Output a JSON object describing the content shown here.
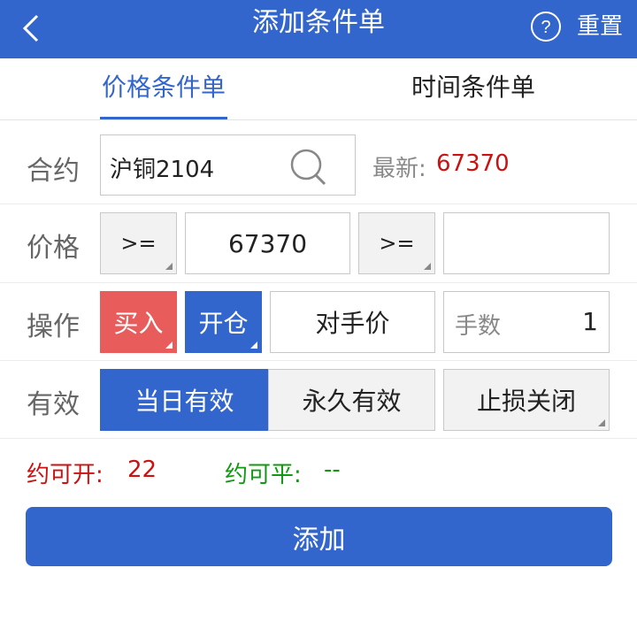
{
  "header": {
    "title": "添加条件单",
    "reset_label": "重置",
    "help_glyph": "?",
    "background": "#3366cc",
    "icons": [
      "back-chevron-icon",
      "help-circle-icon"
    ]
  },
  "tabs": [
    {
      "label": "价格条件单",
      "active": true
    },
    {
      "label": "时间条件单",
      "active": false
    }
  ],
  "contract": {
    "label": "合约",
    "value": "沪铜2104",
    "latest_label": "最新:",
    "latest_value": "67370"
  },
  "price": {
    "label": "价格",
    "op1": ">=",
    "value1": "67370",
    "op2": ">=",
    "value2": ""
  },
  "operation": {
    "label": "操作",
    "direction": "买入",
    "offset": "开仓",
    "price_type": "对手价",
    "qty_label": "手数",
    "qty_value": "1"
  },
  "validity": {
    "label": "有效",
    "options": [
      "当日有效",
      "永久有效"
    ],
    "selected": "当日有效",
    "stop": "止损关闭"
  },
  "summary": {
    "open_label": "约可开:",
    "open_value": "22",
    "close_label": "约可平:",
    "close_value": "--"
  },
  "add_button": "添加",
  "colors": {
    "accent": "#3366cc",
    "buy": "#e85c5c",
    "red_text": "#cc1111",
    "green_text": "#119911"
  }
}
